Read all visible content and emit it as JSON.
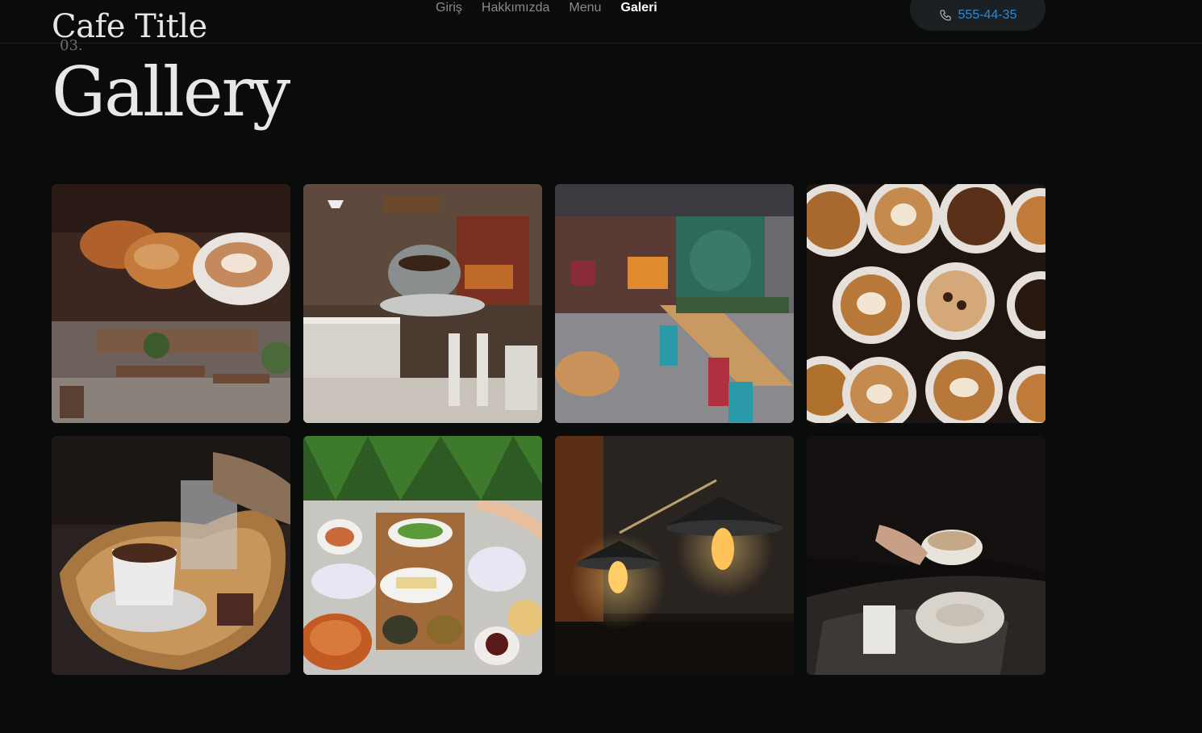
{
  "header": {
    "brand": "Cafe Title",
    "nav": [
      {
        "label": "Giriş",
        "active": false
      },
      {
        "label": "Hakkımızda",
        "active": false
      },
      {
        "label": "Menu",
        "active": false
      },
      {
        "label": "Galeri",
        "active": true
      }
    ],
    "phone": {
      "icon": "phone-icon",
      "number": "555-44-35"
    }
  },
  "gallery": {
    "number": "03.",
    "title": "Gallery",
    "images": [
      {
        "subject": "croissants-and-latte-cafe-interior"
      },
      {
        "subject": "turkish-coffee-and-seating"
      },
      {
        "subject": "cafe-storefront-tables"
      },
      {
        "subject": "latte-art-cups"
      },
      {
        "subject": "turkish-coffee-on-heart-tray"
      },
      {
        "subject": "turkish-breakfast-spread"
      },
      {
        "subject": "pendant-lamps"
      },
      {
        "subject": "hand-holding-cup"
      }
    ]
  },
  "colors": {
    "background": "#0a0b0b",
    "accent": "#2a8ad6",
    "pill": "#1d2022"
  }
}
